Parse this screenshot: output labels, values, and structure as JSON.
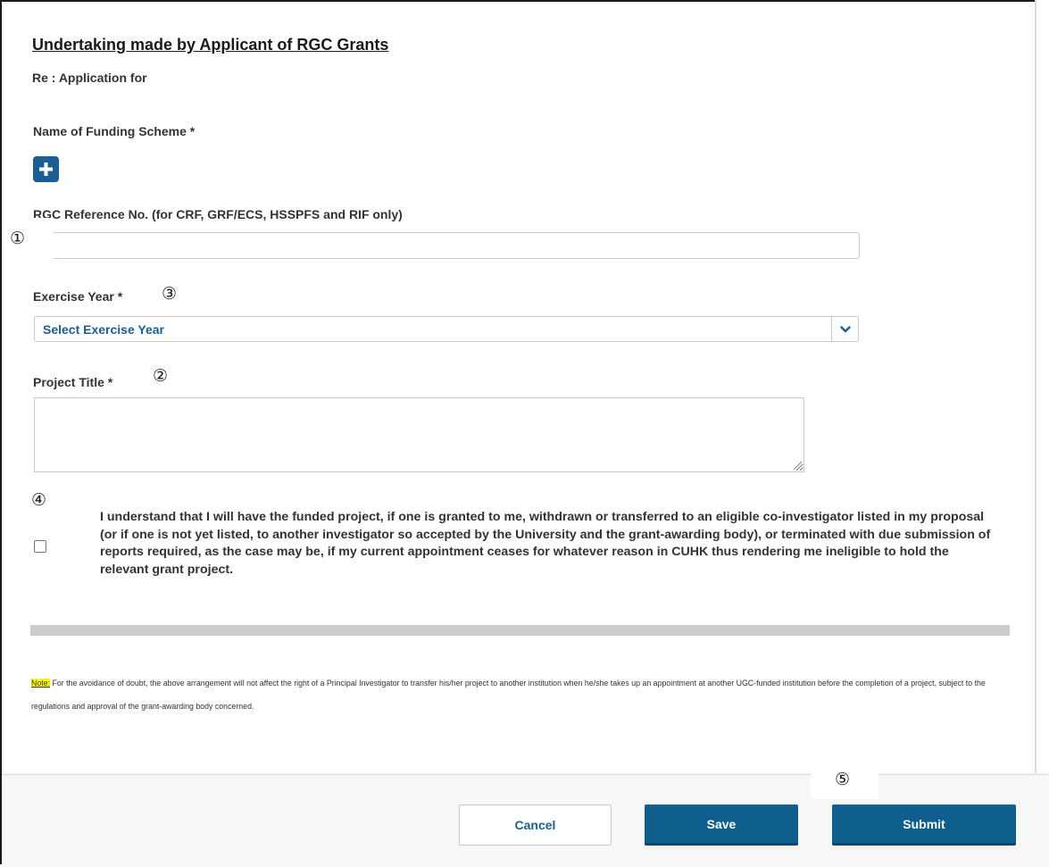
{
  "form": {
    "title": "Undertaking made by Applicant of RGC Grants",
    "re_label": "Re : Application for",
    "funding_scheme_label": "Name of Funding Scheme *",
    "rgc_ref_label": "RGC Reference No. (for CRF, GRF/ECS, HSSPFS and RIF only)",
    "rgc_ref_value": "",
    "exercise_year_label": "Exercise Year *",
    "exercise_year_selected": "Select Exercise Year",
    "project_title_label": "Project Title *",
    "project_title_value": "",
    "undertaking_checked": false,
    "undertaking_text": "I understand that I will have the funded project, if one is granted to me, withdrawn or transferred to an eligible co-investigator listed in my proposal (or if one is not yet listed, to another investigator so accepted by the University and the grant-awarding body), or terminated with due submission of reports required, as the case may be, if my current appointment ceases for whatever reason in CUHK thus rendering me ineligible to hold the relevant grant project."
  },
  "note": {
    "label": "Note:",
    "text": " For the avoidance of doubt, the above arrangement will not affect the right of a Principal Investigator to transfer his/her project to another institution when he/she takes up an appointment at another UGC-funded institution before the completion of a project, subject to the regulations and approval of the grant-awarding body concerned."
  },
  "markers": {
    "m1": "①",
    "m2": "②",
    "m3": "③",
    "m4": "④",
    "m5": "⑤"
  },
  "footer": {
    "cancel_label": "Cancel",
    "save_label": "Save",
    "submit_label": "Submit"
  },
  "colors": {
    "primary": "#0e5e8e",
    "select_text": "#1b5e91",
    "highlight": "#ffff00"
  },
  "icons": {
    "add": "plus-icon",
    "dropdown": "chevron-down-icon",
    "resize": "resize-grip-icon"
  }
}
